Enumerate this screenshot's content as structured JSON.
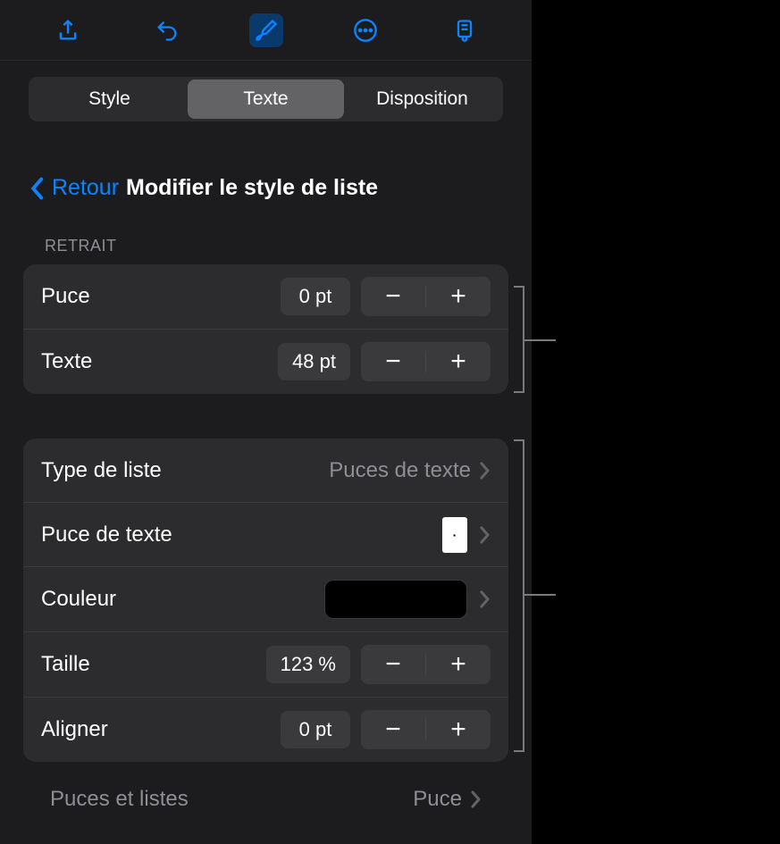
{
  "tabs": {
    "style": "Style",
    "text": "Texte",
    "layout": "Disposition"
  },
  "header": {
    "back": "Retour",
    "title": "Modifier le style de liste"
  },
  "indent": {
    "section": "Retrait",
    "bullet_label": "Puce",
    "bullet_value": "0 pt",
    "text_label": "Texte",
    "text_value": "48 pt"
  },
  "list": {
    "type_label": "Type de liste",
    "type_value": "Puces de texte",
    "text_bullet_label": "Puce de texte",
    "text_bullet_glyph": "·",
    "color_label": "Couleur",
    "size_label": "Taille",
    "size_value": "123 %",
    "align_label": "Aligner",
    "align_value": "0 pt"
  },
  "footer": {
    "label": "Puces et listes",
    "value": "Puce"
  }
}
